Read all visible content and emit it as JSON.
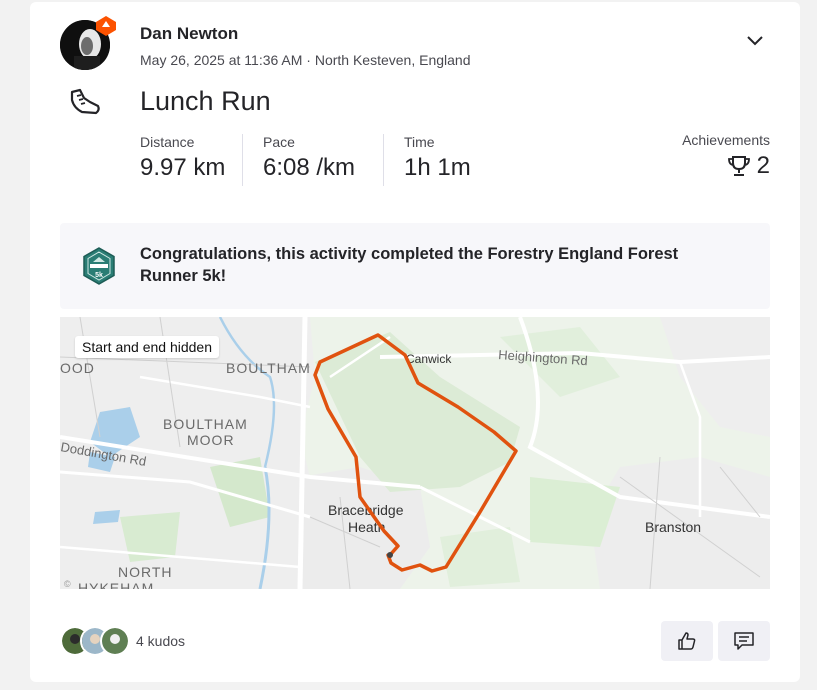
{
  "athlete": {
    "name": "Dan Newton",
    "meta": "May 26, 2025 at 11:36 AM · North Kesteven, England"
  },
  "activity": {
    "title": "Lunch Run",
    "type_icon": "running-shoe-icon",
    "stats": [
      {
        "label": "Distance",
        "value": "9.97 km"
      },
      {
        "label": "Pace",
        "value": "6:08 /km"
      },
      {
        "label": "Time",
        "value": "1h 1m"
      }
    ],
    "achievements": {
      "label": "Achievements",
      "count": "2",
      "icon": "trophy-icon"
    }
  },
  "banner": {
    "icon": "forest-runner-badge-icon",
    "text": "Congratulations, this activity completed the Forestry England Forest Runner 5k!"
  },
  "map": {
    "privacy_label": "Start and end hidden",
    "labels": {
      "ood": "OOD",
      "boultham": "BOULTHAM",
      "boultham_moor_1": "BOULTHAM",
      "boultham_moor_2": "MOOR",
      "doddington": "Doddington Rd",
      "canwick": "Canwick",
      "heighington": "Heighington Rd",
      "bracebridge_1": "Bracebridge",
      "bracebridge_2": "Heath",
      "branston": "Branston",
      "north_1": "NORTH",
      "north_2": "HYKEHAM"
    },
    "route_color": "#e0520f"
  },
  "social": {
    "kudos_text": "4 kudos",
    "like_icon": "thumbs-up-icon",
    "comment_icon": "comment-icon"
  }
}
